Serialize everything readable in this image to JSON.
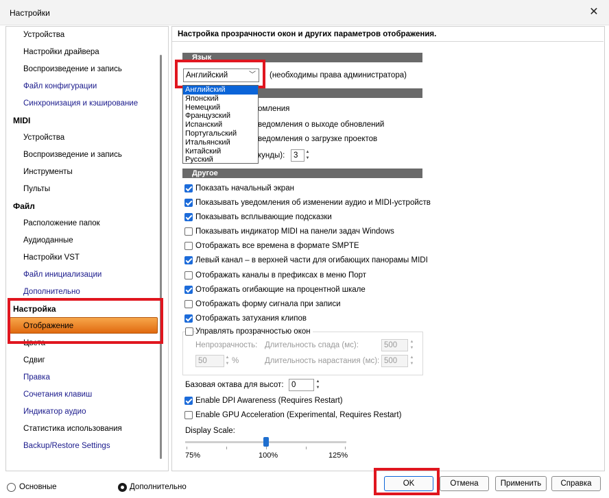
{
  "window": {
    "title": "Настройки"
  },
  "sidebar": {
    "items": [
      {
        "label": "Устройства",
        "kind": "item"
      },
      {
        "label": "Настройки драйвера",
        "kind": "item"
      },
      {
        "label": "Воспроизведение и запись",
        "kind": "item"
      },
      {
        "label": "Файл конфигурации",
        "kind": "blue"
      },
      {
        "label": "Синхронизация и кэширование",
        "kind": "blue"
      },
      {
        "label": "MIDI",
        "kind": "header"
      },
      {
        "label": "Устройства",
        "kind": "item"
      },
      {
        "label": "Воспроизведение и запись",
        "kind": "item"
      },
      {
        "label": "Инструменты",
        "kind": "item"
      },
      {
        "label": "Пульты",
        "kind": "item"
      },
      {
        "label": "Файл",
        "kind": "header"
      },
      {
        "label": "Расположение папок",
        "kind": "item"
      },
      {
        "label": "Аудиоданные",
        "kind": "item"
      },
      {
        "label": "Настройки VST",
        "kind": "item"
      },
      {
        "label": "Файл инициализации",
        "kind": "blue"
      },
      {
        "label": "Дополнительно",
        "kind": "blue"
      },
      {
        "label": "Настройка",
        "kind": "header"
      },
      {
        "label": "Отображение",
        "kind": "selected"
      },
      {
        "label": "Цвета",
        "kind": "item"
      },
      {
        "label": "Сдвиг",
        "kind": "item"
      },
      {
        "label": "Правка",
        "kind": "blue"
      },
      {
        "label": "Сочетания клавиш",
        "kind": "blue"
      },
      {
        "label": "Индикатор аудио",
        "kind": "blue"
      },
      {
        "label": "Статистика использования",
        "kind": "item"
      },
      {
        "label": "Backup/Restore Settings",
        "kind": "blue"
      }
    ]
  },
  "main": {
    "header": "Настройка прозрачности окон и других параметров отображения.",
    "language": {
      "section": "Язык",
      "selected": "Английский",
      "note": "(необходимы права администратора)",
      "options": [
        "Английский",
        "Японский",
        "Немецкий",
        "Французский",
        "Испанский",
        "Португальский",
        "Итальянский",
        "Китайский",
        "Русский"
      ]
    },
    "notifications": {
      "partial1": "омления",
      "partial2": "ведомления о выходе обновлений",
      "partial3": "ведомления о загрузке проектов",
      "partial4": "кунды):",
      "seconds_value": "3"
    },
    "other": {
      "section": "Другое",
      "options": [
        {
          "label": "Показать начальный экран",
          "checked": true
        },
        {
          "label": "Показывать уведомления об изменении аудио и MIDI-устройств",
          "checked": true
        },
        {
          "label": "Показывать всплывающие подсказки",
          "checked": true
        },
        {
          "label": "Показывать индикатор MIDI на панели задач Windows",
          "checked": false
        },
        {
          "label": "Отображать все времена в формате SMPTE",
          "checked": false
        },
        {
          "label": "Левый канал – в верхней части для огибающих панорамы MIDI",
          "checked": true
        },
        {
          "label": "Отображать каналы в префиксах в меню Порт",
          "checked": false
        },
        {
          "label": "Отображать огибающие на процентной шкале",
          "checked": true
        },
        {
          "label": "Отображать форму сигнала при записи",
          "checked": false
        },
        {
          "label": "Отображать затухания клипов",
          "checked": true
        }
      ]
    },
    "transparency": {
      "label": "Управлять прозрачностью окон",
      "checked": false,
      "opacity_label": "Непрозрачность:",
      "opacity_value": "50",
      "percent": "%",
      "fadeout_label": "Длительность спада (мс):",
      "fadeout_value": "500",
      "fadein_label": "Длительность нарастания (мс):",
      "fadein_value": "500"
    },
    "base_octave": {
      "label": "Базовая октава для высот:",
      "value": "0"
    },
    "dpi": {
      "label": "Enable DPI Awareness (Requires Restart)",
      "checked": true
    },
    "gpu": {
      "label": "Enable GPU Acceleration (Experimental, Requires Restart)",
      "checked": false
    },
    "display_scale": {
      "label": "Display Scale:",
      "min_label": "75%",
      "mid_label": "100%",
      "max_label": "125%",
      "value_percent": 100
    }
  },
  "footer": {
    "mode_basic": "Основные",
    "mode_advanced": "Дополнительно",
    "mode_selected": "advanced",
    "ok": "OK",
    "cancel": "Отмена",
    "apply": "Применить",
    "help": "Справка"
  },
  "colors": {
    "accent": "#1c6bd9",
    "selected_item": "#e9761a",
    "highlight_frame": "#e0161f",
    "section_bar": "#6a6a6a"
  }
}
